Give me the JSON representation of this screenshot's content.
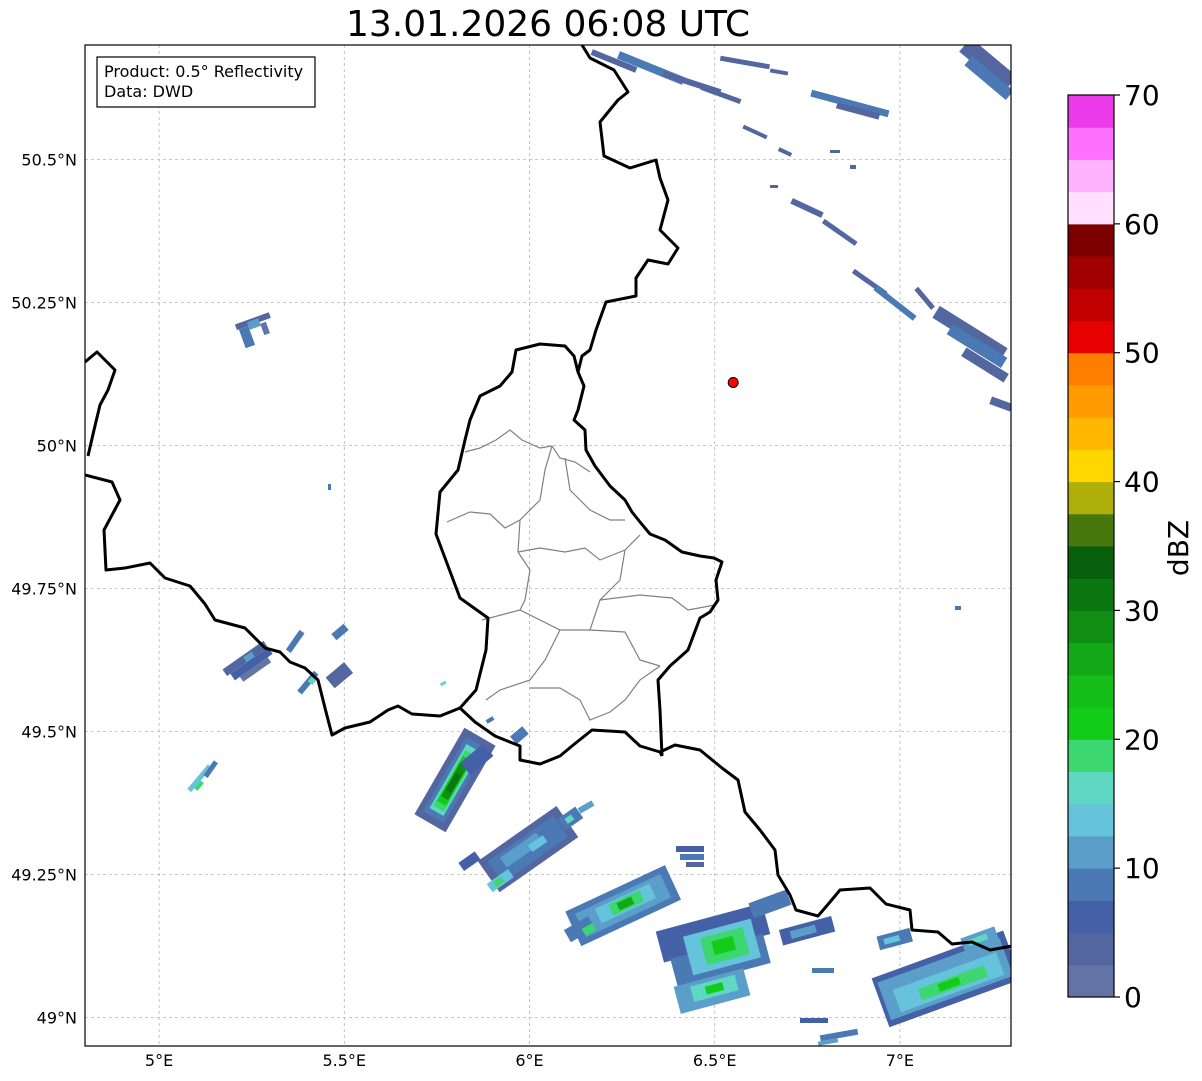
{
  "title": "13.01.2026 06:08 UTC",
  "info_box": {
    "product": "Product: 0.5° Reflectivity",
    "data": "Data: DWD"
  },
  "map": {
    "lon_range": [
      4.8,
      7.3
    ],
    "lat_range": [
      48.95,
      50.7
    ],
    "lon_ticks": [
      {
        "value": 5.0,
        "label": "5°E"
      },
      {
        "value": 5.5,
        "label": "5.5°E"
      },
      {
        "value": 6.0,
        "label": "6°E"
      },
      {
        "value": 6.5,
        "label": "6.5°E"
      },
      {
        "value": 7.0,
        "label": "7°E"
      }
    ],
    "lat_ticks": [
      {
        "value": 50.5,
        "label": "50.5°N"
      },
      {
        "value": 50.25,
        "label": "50.25°N"
      },
      {
        "value": 50.0,
        "label": "50°N"
      },
      {
        "value": 49.75,
        "label": "49.75°N"
      },
      {
        "value": 49.5,
        "label": "49.5°N"
      },
      {
        "value": 49.25,
        "label": "49.25°N"
      },
      {
        "value": 49.0,
        "label": "49°N"
      }
    ],
    "gridlines": true,
    "radar_site": {
      "lon": 6.55,
      "lat": 50.11,
      "color": "#ff0000"
    }
  },
  "colorbar": {
    "label": "dBZ",
    "range": [
      0,
      70
    ],
    "tick_values": [
      0,
      10,
      20,
      30,
      40,
      50,
      60,
      70
    ],
    "tick_labels": [
      "0",
      "10",
      "20",
      "30",
      "40",
      "50",
      "60",
      "70"
    ],
    "colors": [
      "#6473a6",
      "#5366a0",
      "#4460a6",
      "#4a79b3",
      "#5a9ec9",
      "#66c3dc",
      "#5fd7c2",
      "#3dd770",
      "#13cc1a",
      "#15bd18",
      "#13a816",
      "#0f8e13",
      "#0b7710",
      "#075e0b",
      "#48780b",
      "#aeb009",
      "#ffd700",
      "#ffb700",
      "#ff9a00",
      "#ff7e00",
      "#e60000",
      "#c30000",
      "#a00000",
      "#7c0000",
      "#ffe0ff",
      "#ffb3ff",
      "#ff70ff",
      "#ea3aea"
    ]
  },
  "chart_data": {
    "type": "heatmap",
    "title": "13.01.2026 06:08 UTC",
    "xlabel": "",
    "ylabel": "",
    "xlim": [
      4.8,
      7.3
    ],
    "ylim": [
      48.95,
      50.7
    ],
    "value_label": "dBZ",
    "value_range": [
      0,
      70
    ],
    "echoes": [
      {
        "lon": 5.26,
        "lat": 50.22,
        "dbz": 5
      },
      {
        "lon": 5.12,
        "lat": 49.42,
        "dbz": 15
      },
      {
        "lon": 5.25,
        "lat": 49.65,
        "dbz": 8
      },
      {
        "lon": 5.52,
        "lat": 49.63,
        "dbz": 6
      },
      {
        "lon": 5.82,
        "lat": 49.42,
        "dbz": 25
      },
      {
        "lon": 5.79,
        "lat": 49.37,
        "dbz": 30
      },
      {
        "lon": 6.0,
        "lat": 49.28,
        "dbz": 8
      },
      {
        "lon": 6.25,
        "lat": 49.18,
        "dbz": 20
      },
      {
        "lon": 6.55,
        "lat": 49.12,
        "dbz": 18
      },
      {
        "lon": 7.12,
        "lat": 49.05,
        "dbz": 20
      },
      {
        "lon": 6.75,
        "lat": 50.55,
        "dbz": 4
      },
      {
        "lon": 7.18,
        "lat": 50.15,
        "dbz": 4
      }
    ]
  }
}
